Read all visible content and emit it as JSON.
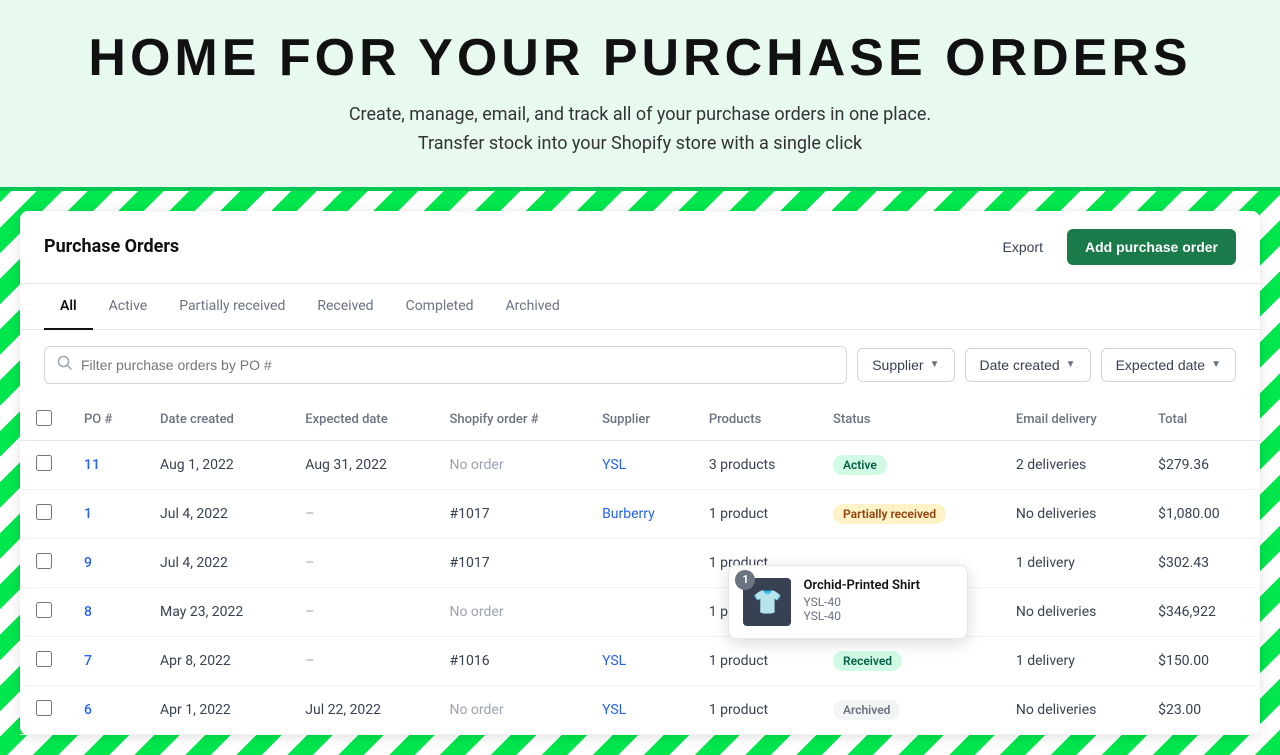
{
  "hero": {
    "title": "HOME  FOR  YOUR  PURCHASE  ORDERS",
    "subtitle_line1": "Create, manage, email, and track all of your purchase orders in one place.",
    "subtitle_line2": "Transfer stock into your Shopify store with a single click"
  },
  "panel": {
    "title": "Purchase Orders",
    "export_label": "Export",
    "add_label": "Add purchase order"
  },
  "tabs": [
    {
      "id": "all",
      "label": "All",
      "active": true
    },
    {
      "id": "active",
      "label": "Active",
      "active": false
    },
    {
      "id": "partially",
      "label": "Partially received",
      "active": false
    },
    {
      "id": "received",
      "label": "Received",
      "active": false
    },
    {
      "id": "completed",
      "label": "Completed",
      "active": false
    },
    {
      "id": "archived",
      "label": "Archived",
      "active": false
    }
  ],
  "filters": {
    "search_placeholder": "Filter purchase orders by PO #",
    "supplier_label": "Supplier",
    "date_created_label": "Date created",
    "expected_date_label": "Expected date"
  },
  "table": {
    "columns": [
      "PO #",
      "Date created",
      "Expected date",
      "Shopify order #",
      "Supplier",
      "Products",
      "Status",
      "Email delivery",
      "Total"
    ],
    "rows": [
      {
        "po": "11",
        "date_created": "Aug 1, 2022",
        "expected_date": "Aug 31, 2022",
        "shopify_order": "No order",
        "supplier": "YSL",
        "products": "3 products",
        "status": "Active",
        "status_type": "active",
        "email_delivery": "2 deliveries",
        "total": "$279.36",
        "has_popover": false
      },
      {
        "po": "1",
        "date_created": "Jul 4, 2022",
        "expected_date": "–",
        "shopify_order": "#1017",
        "supplier": "Burberry",
        "products": "1 product",
        "status": "Partially received",
        "status_type": "partial",
        "email_delivery": "No deliveries",
        "total": "$1,080.00",
        "has_popover": false
      },
      {
        "po": "9",
        "date_created": "Jul 4, 2022",
        "expected_date": "–",
        "shopify_order": "#1017",
        "supplier": "",
        "products": "1 product",
        "status": "",
        "status_type": "",
        "email_delivery": "1 delivery",
        "total": "$302.43",
        "has_popover": true
      },
      {
        "po": "8",
        "date_created": "May 23, 2022",
        "expected_date": "–",
        "shopify_order": "No order",
        "supplier": "",
        "products": "1 product",
        "status": "",
        "status_type": "",
        "email_delivery": "No deliveries",
        "total": "$346,922",
        "has_popover": false
      },
      {
        "po": "7",
        "date_created": "Apr 8, 2022",
        "expected_date": "–",
        "shopify_order": "#1016",
        "supplier": "YSL",
        "products": "1 product",
        "status": "Received",
        "status_type": "received",
        "email_delivery": "1 delivery",
        "total": "$150.00",
        "has_popover": false
      },
      {
        "po": "6",
        "date_created": "Apr 1, 2022",
        "expected_date": "Jul 22, 2022",
        "shopify_order": "No order",
        "supplier": "YSL",
        "products": "1 product",
        "status": "Archived",
        "status_type": "archived",
        "email_delivery": "No deliveries",
        "total": "$23.00",
        "has_popover": false
      }
    ]
  },
  "popover": {
    "badge_count": "1",
    "product_name": "Orchid-Printed Shirt",
    "sku1": "YSL-40",
    "sku2": "YSL-40"
  }
}
